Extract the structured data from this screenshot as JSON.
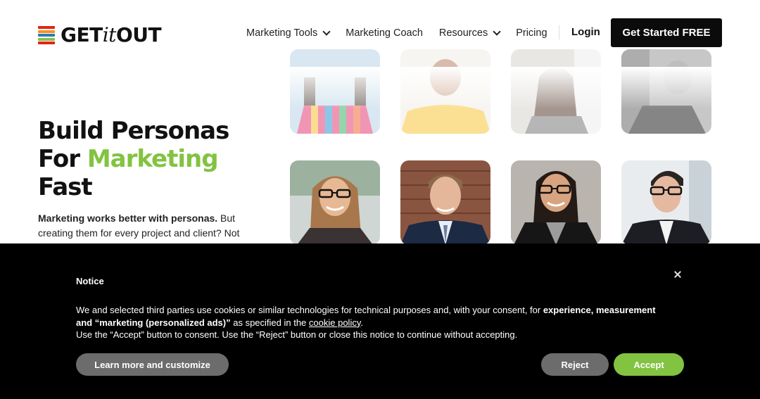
{
  "brand": {
    "name_part1": "GET",
    "name_part2": "it",
    "name_part3": "OUT",
    "logo_colors": [
      "#e2231a",
      "#f7941d",
      "#2e7ab8",
      "#82c341",
      "#e2231a"
    ]
  },
  "nav": {
    "items": [
      {
        "label": "Marketing Tools",
        "has_dropdown": true
      },
      {
        "label": "Marketing Coach",
        "has_dropdown": false
      },
      {
        "label": "Resources",
        "has_dropdown": true
      },
      {
        "label": "Pricing",
        "has_dropdown": false
      }
    ],
    "login": "Login",
    "cta": "Get Started FREE"
  },
  "hero": {
    "title_line1": "Build Personas",
    "title_for": "For ",
    "title_highlight": "Marketing",
    "title_line3": "Fast",
    "sub_bold": "Marketing works better with personas.",
    "sub_rest": " But creating them for every project and client? Not"
  },
  "colors": {
    "accent_green": "#82c341",
    "banner_bg": "#000000",
    "button_gray": "#6c6c6c"
  },
  "cookie_notice": {
    "title": "Notice",
    "text_part1": "We and selected third parties use cookies or similar technologies for technical purposes and, with your consent, for ",
    "text_bold": "experience, measurement and “marketing (personalized ads)”",
    "text_part2": " as specified in the ",
    "link": "cookie policy",
    "text_part3": ".",
    "text_line2": "Use the “Accept” button to consent. Use the “Reject” button or close this notice to continue without accepting.",
    "learn_more": "Learn more and customize",
    "reject": "Reject",
    "accept": "Accept"
  }
}
